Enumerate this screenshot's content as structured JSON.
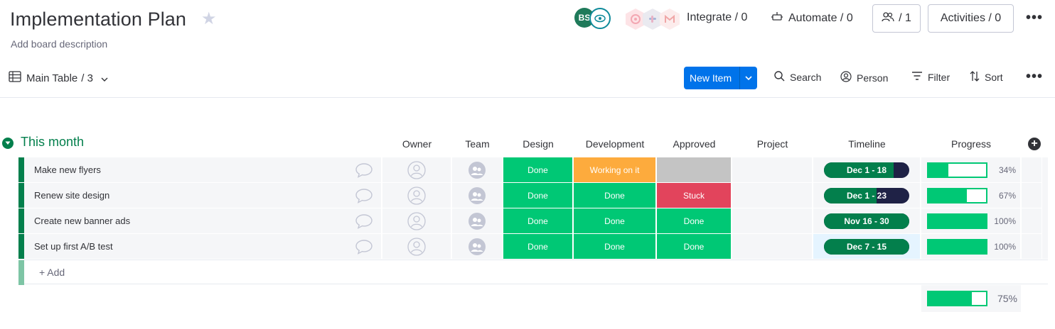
{
  "board": {
    "title": "Implementation Plan",
    "description": "Add board description"
  },
  "header": {
    "avatar_initials": "BS",
    "integrate_label": "Integrate / 0",
    "automate_label": "Automate / 0",
    "members_label": "/ 1",
    "activities_label": "Activities / 0",
    "more": "•••",
    "colors": {
      "brand_blue": "#0073ea",
      "done_green": "#00c875",
      "group_green": "#037f4c"
    }
  },
  "toolbar": {
    "view_label": "Main Table",
    "view_count": "/ 3",
    "new_item": "New Item",
    "search": "Search",
    "person": "Person",
    "filter": "Filter",
    "sort": "Sort",
    "more": "•••"
  },
  "group": {
    "title": "This month",
    "columns": {
      "owner": "Owner",
      "team": "Team",
      "design": "Design",
      "development": "Development",
      "approved": "Approved",
      "project": "Project",
      "timeline": "Timeline",
      "progress": "Progress"
    },
    "rows": [
      {
        "name": "Make new flyers",
        "design": "Done",
        "development": "Working on it",
        "approved": "",
        "timeline": "Dec 1 - 18",
        "timeline_elapsed": 0.82,
        "progress": 0.34,
        "progress_label": "34%"
      },
      {
        "name": "Renew site design",
        "design": "Done",
        "development": "Done",
        "approved": "Stuck",
        "timeline": "Dec 1 - 23",
        "timeline_elapsed": 0.62,
        "progress": 0.67,
        "progress_label": "67%"
      },
      {
        "name": "Create new banner ads",
        "design": "Done",
        "development": "Done",
        "approved": "Done",
        "timeline": "Nov 16 - 30",
        "timeline_elapsed": 1.0,
        "progress": 1.0,
        "progress_label": "100%"
      },
      {
        "name": "Set up first A/B test",
        "design": "Done",
        "development": "Done",
        "approved": "Done",
        "timeline": "Dec 7 - 15",
        "timeline_elapsed": 1.0,
        "progress": 1.0,
        "progress_label": "100%"
      }
    ],
    "add_label": "+ Add",
    "summary_progress": 0.75,
    "summary_label": "75%"
  }
}
